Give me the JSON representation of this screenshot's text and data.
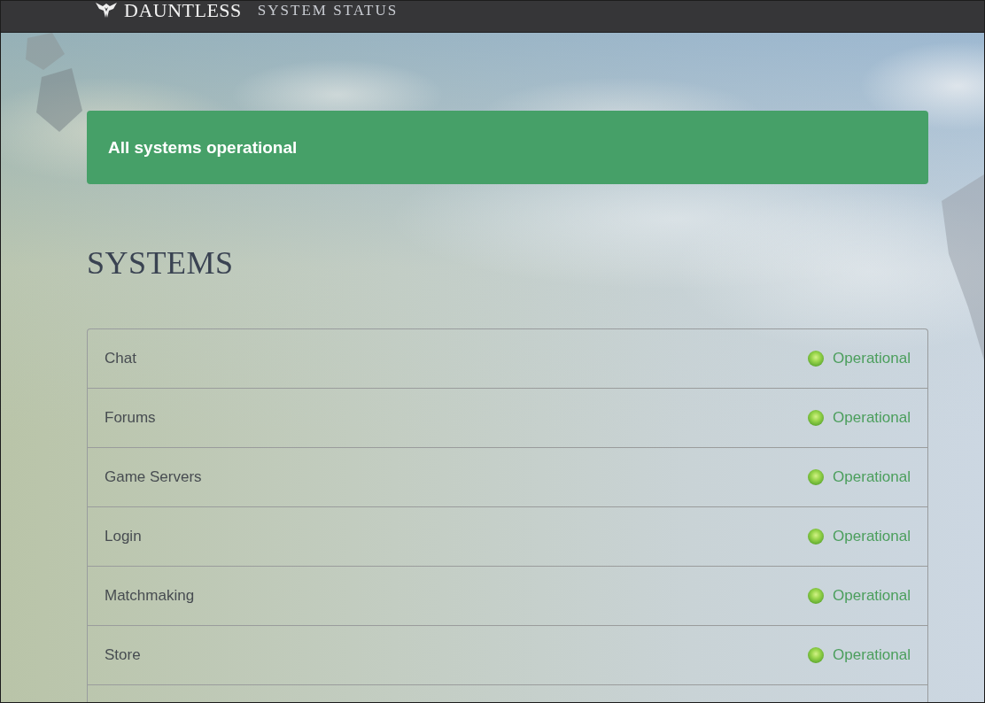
{
  "header": {
    "logo": "DAUNTLESS",
    "title": "SYSTEM STATUS"
  },
  "banner": {
    "text": "All systems operational"
  },
  "section": {
    "title": "SYSTEMS"
  },
  "systems": [
    {
      "name": "Chat",
      "status": "Operational"
    },
    {
      "name": "Forums",
      "status": "Operational"
    },
    {
      "name": "Game Servers",
      "status": "Operational"
    },
    {
      "name": "Login",
      "status": "Operational"
    },
    {
      "name": "Matchmaking",
      "status": "Operational"
    },
    {
      "name": "Store",
      "status": "Operational"
    }
  ]
}
